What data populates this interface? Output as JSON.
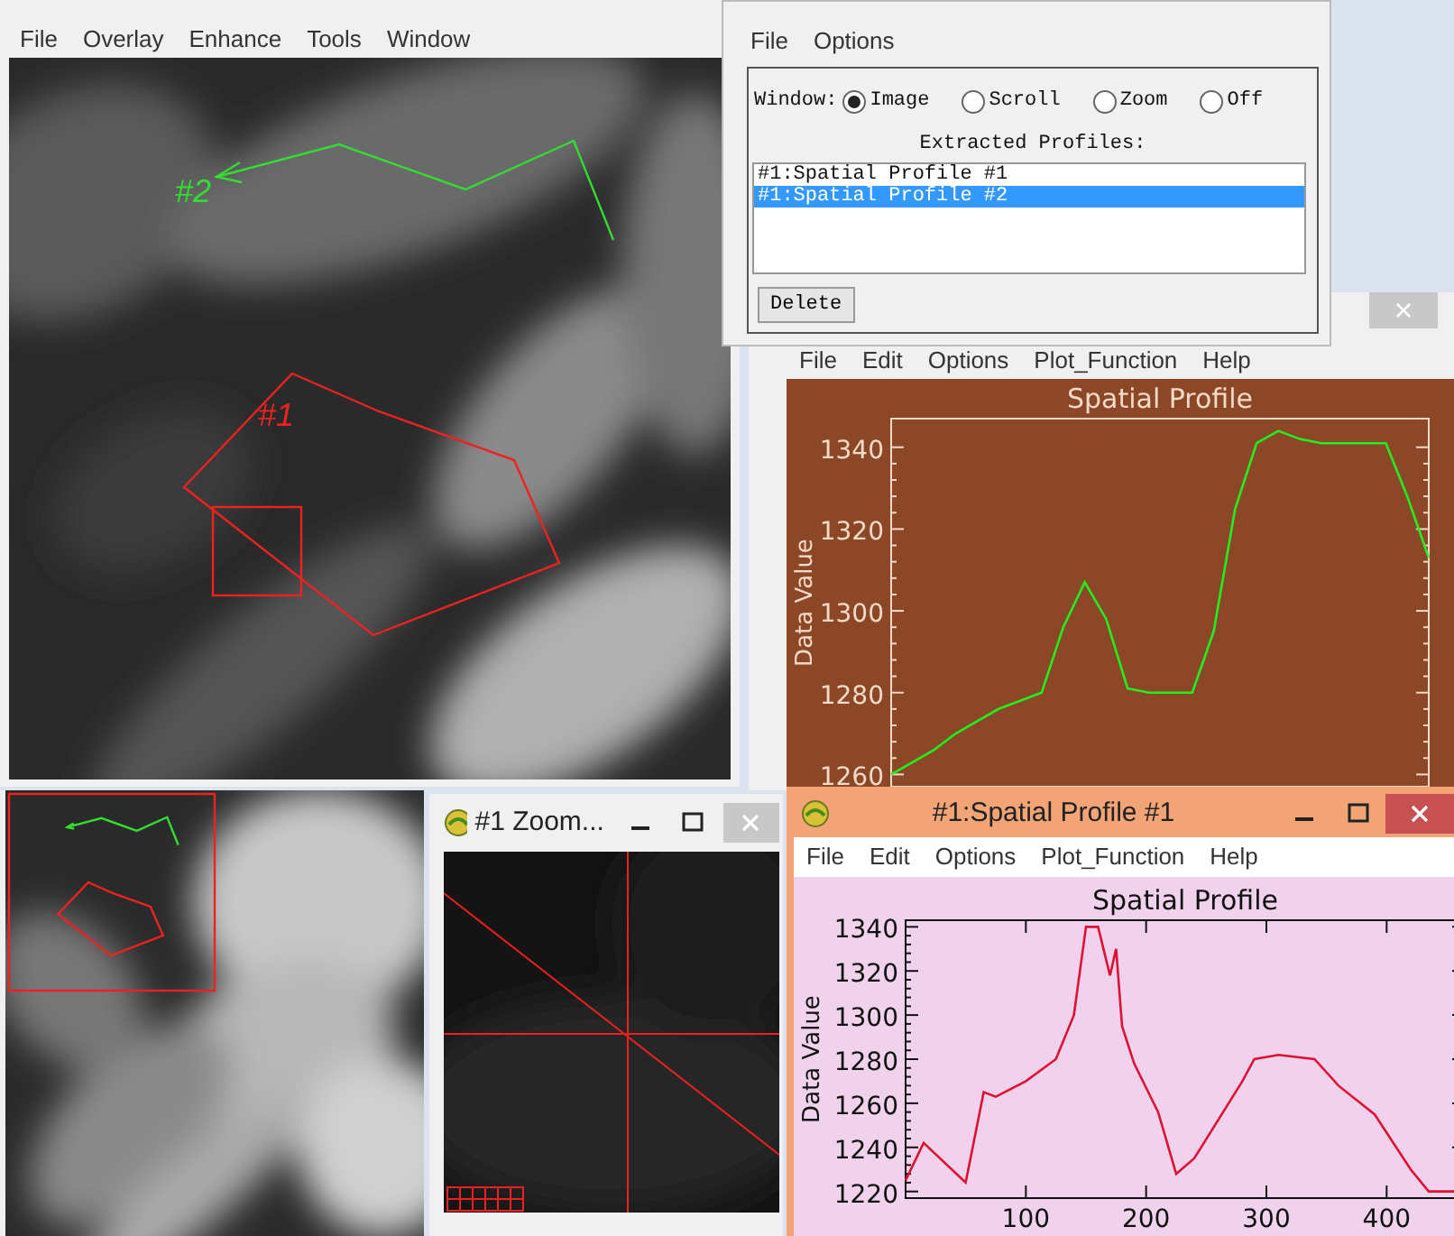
{
  "image_window": {
    "menu": [
      "File",
      "Overlay",
      "Enhance",
      "Tools",
      "Window"
    ],
    "overlays": [
      {
        "kind": "line",
        "label": "#2",
        "color": "#33dd33"
      },
      {
        "kind": "polygon",
        "label": "#1",
        "color": "#ee2222"
      }
    ]
  },
  "profile_tool": {
    "menu": [
      "File",
      "Options"
    ],
    "window_label": "Window:",
    "window_options": [
      {
        "label": "Image",
        "selected": true
      },
      {
        "label": "Scroll",
        "selected": false
      },
      {
        "label": "Zoom",
        "selected": false
      },
      {
        "label": "Off",
        "selected": false
      }
    ],
    "list_label": "Extracted Profiles:",
    "profiles": [
      {
        "label": "#1:Spatial Profile #1",
        "selected": false
      },
      {
        "label": "#1:Spatial Profile #2",
        "selected": true
      }
    ],
    "delete_button": "Delete"
  },
  "profile_plot_2": {
    "menu": [
      "File",
      "Edit",
      "Options",
      "Plot_Function",
      "Help"
    ],
    "close_glyph": "×",
    "chart_data": {
      "type": "line",
      "title": "Spatial Profile",
      "ylabel": "Data Value",
      "ylim": [
        1257,
        1347
      ],
      "yticks": [
        1260,
        1280,
        1300,
        1320,
        1340
      ],
      "series": [
        {
          "color": "#22ee22",
          "values": [
            1260,
            1263,
            1266,
            1270,
            1273,
            1276,
            1278,
            1280,
            1296,
            1307,
            1298,
            1281,
            1280,
            1280,
            1280,
            1295,
            1325,
            1341,
            1344,
            1342,
            1341,
            1341,
            1341,
            1341,
            1328,
            1313
          ]
        }
      ]
    }
  },
  "zoom_window": {
    "title": "#1 Zoom..."
  },
  "profile_plot_1": {
    "title": "#1:Spatial Profile #1",
    "menu": [
      "File",
      "Edit",
      "Options",
      "Plot_Function",
      "Help"
    ],
    "chart_data": {
      "type": "line",
      "title": "Spatial Profile",
      "ylabel": "Data Value",
      "xlim": [
        0,
        465
      ],
      "ylim": [
        1217,
        1343
      ],
      "xticks": [
        100,
        200,
        300,
        400
      ],
      "yticks": [
        1220,
        1240,
        1260,
        1280,
        1300,
        1320,
        1340
      ],
      "x": [
        0,
        15,
        50,
        65,
        75,
        100,
        125,
        140,
        150,
        160,
        170,
        175,
        180,
        190,
        210,
        225,
        240,
        280,
        290,
        310,
        340,
        360,
        390,
        420,
        435,
        461
      ],
      "series": [
        {
          "color": "#dd1133",
          "values": [
            1225,
            1242,
            1224,
            1265,
            1263,
            1270,
            1280,
            1300,
            1340,
            1340,
            1318,
            1330,
            1295,
            1278,
            1256,
            1228,
            1235,
            1270,
            1280,
            1282,
            1280,
            1268,
            1255,
            1230,
            1220,
            1220
          ]
        }
      ]
    }
  }
}
